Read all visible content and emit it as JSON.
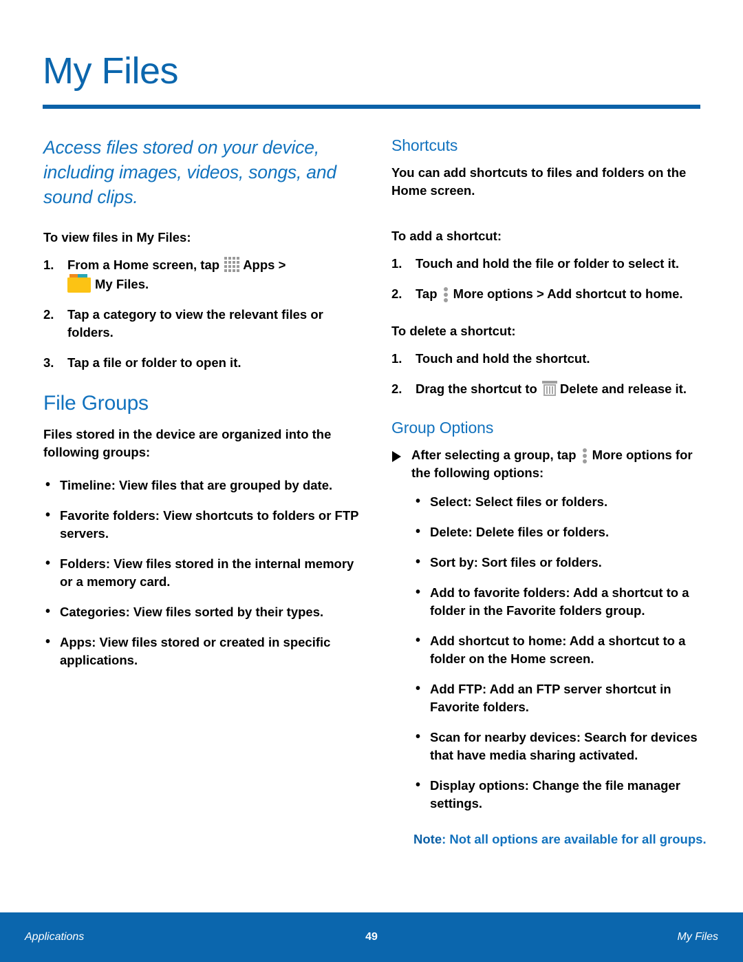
{
  "page": {
    "title": "My Files"
  },
  "left_column": {
    "lead": "Access files stored on your device, including images, videos, songs, and sound clips.",
    "intro_line": "To view files in My Files:",
    "steps": [
      {
        "number": "1.",
        "text_before_apps_icon": "From a Home screen, tap ",
        "apps_icon": "apps-grid-icon",
        "apps_label": "Apps",
        "separator": " > ",
        "folder_icon": "my-files-folder-icon",
        "myfiles_label": "My Files",
        "text_after": "."
      },
      {
        "number": "2.",
        "text": "Tap a category to view the relevant files or folders."
      },
      {
        "number": "3.",
        "text": "Tap a file or folder to open it."
      }
    ],
    "file_groups": {
      "heading": "File Groups",
      "intro": "Files stored in the device are organized into the following groups:",
      "bullets": [
        {
          "term": "Timeline",
          "desc": ": View files that are grouped by date."
        },
        {
          "term": "Favorite folders",
          "desc": ": View shortcuts to folders or FTP servers."
        },
        {
          "term": "Folders",
          "desc": ": View files stored in the internal memory or a memory card."
        },
        {
          "term": "Categories",
          "desc": ": View files sorted by their types."
        },
        {
          "term": "Apps",
          "desc": ": View files stored or created in specific applications."
        }
      ]
    }
  },
  "right_column": {
    "shortcuts": {
      "heading": "Shortcuts",
      "intro": "You can add shortcuts to files and folders on the Home screen.",
      "add_label": "To add a shortcut:",
      "add_steps": [
        {
          "number": "1.",
          "text": "Touch and hold the file or folder to select it."
        },
        {
          "number": "2.",
          "text_before": "Tap ",
          "dots_icon": "more-options-icon",
          "bold_text": "More options > Add shortcut to home",
          "text_after": "."
        }
      ],
      "delete_label": "To delete a shortcut:",
      "delete_steps": [
        {
          "number": "1.",
          "text": "Touch and hold the shortcut."
        },
        {
          "number": "2.",
          "text_before": "Drag the shortcut to ",
          "trash_icon": "delete-trash-icon",
          "bold_text": "Delete",
          "text_after": " and release it."
        }
      ]
    },
    "group_options": {
      "heading": "Group Options",
      "lead_before": "After selecting a group, tap ",
      "lead_dots_icon": "more-options-icon",
      "lead_bold": "More options",
      "lead_after": " for the following options:",
      "bullets": [
        {
          "term": "Select",
          "desc": ": Select files or folders."
        },
        {
          "term": "Delete",
          "desc": ": Delete files or folders."
        },
        {
          "term": "Sort by",
          "desc": ": Sort files or folders."
        },
        {
          "term": "Add to favorite folders",
          "desc": ": Add a shortcut to a folder in the Favorite folders group."
        },
        {
          "term": "Add shortcut to home",
          "desc": ": Add a shortcut to a folder on the Home screen."
        },
        {
          "term": "Add FTP",
          "desc": ": Add an FTP server shortcut in Favorite folders."
        },
        {
          "term": "Scan for nearby devices",
          "desc": ": Search for devices that have media sharing activated."
        },
        {
          "term": "Display options",
          "desc": ": Change the file manager settings."
        }
      ],
      "note_label": "Note",
      "note_text": ": Not all options are available for all groups."
    }
  },
  "footer": {
    "left": "Applications",
    "page_number": "49",
    "right": "My Files"
  },
  "colors": {
    "brand_blue": "#0b66ad",
    "heading_blue": "#1272be",
    "rule_blue": "#0b61a8",
    "folder_yellow": "#fcc314",
    "icon_gray": "#9d9d9d"
  }
}
